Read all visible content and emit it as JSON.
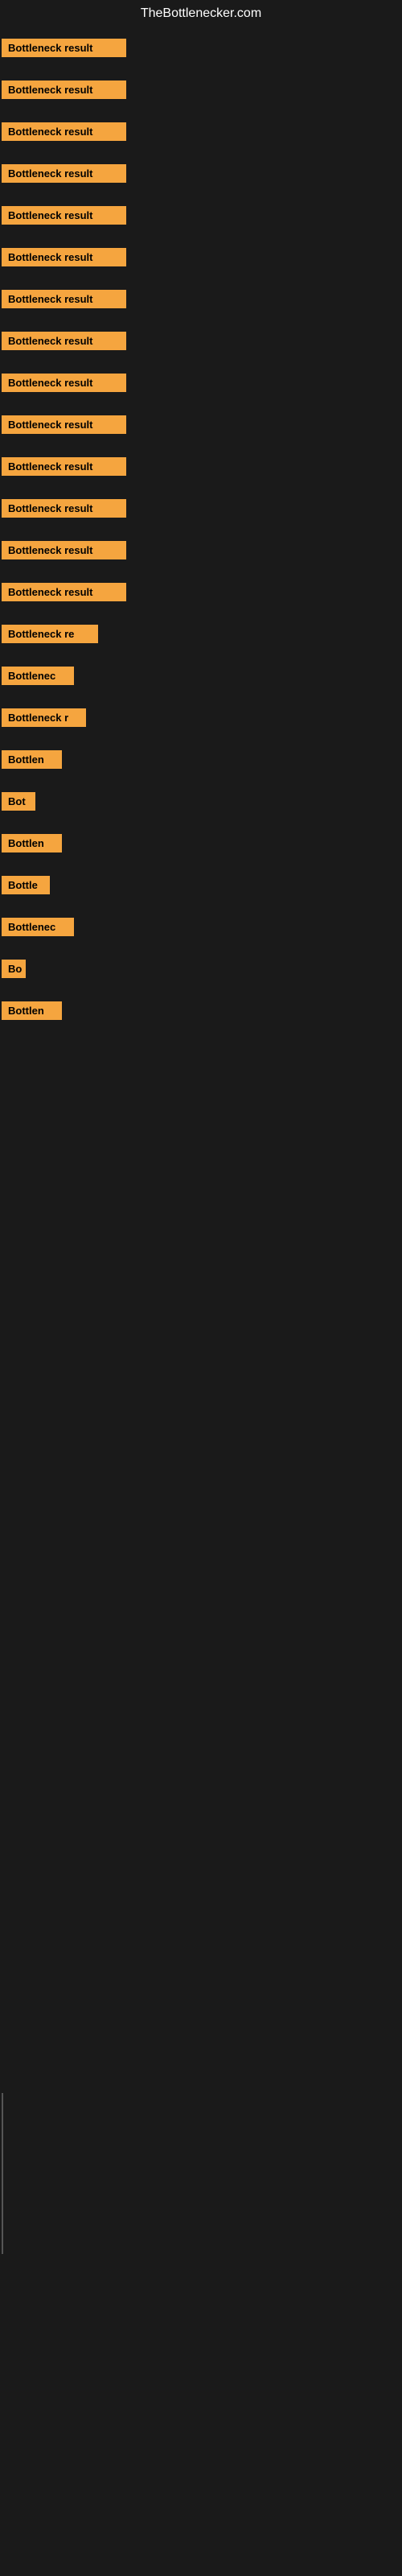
{
  "site": {
    "title": "TheBottlenecker.com"
  },
  "bars": [
    {
      "label": "Bottleneck result",
      "width": 155
    },
    {
      "label": "Bottleneck result",
      "width": 155
    },
    {
      "label": "Bottleneck result",
      "width": 155
    },
    {
      "label": "Bottleneck result",
      "width": 155
    },
    {
      "label": "Bottleneck result",
      "width": 155
    },
    {
      "label": "Bottleneck result",
      "width": 155
    },
    {
      "label": "Bottleneck result",
      "width": 155
    },
    {
      "label": "Bottleneck result",
      "width": 155
    },
    {
      "label": "Bottleneck result",
      "width": 155
    },
    {
      "label": "Bottleneck result",
      "width": 155
    },
    {
      "label": "Bottleneck result",
      "width": 155
    },
    {
      "label": "Bottleneck result",
      "width": 155
    },
    {
      "label": "Bottleneck result",
      "width": 155
    },
    {
      "label": "Bottleneck result",
      "width": 155
    },
    {
      "label": "Bottleneck re",
      "width": 120
    },
    {
      "label": "Bottlenec",
      "width": 90
    },
    {
      "label": "Bottleneck r",
      "width": 105
    },
    {
      "label": "Bottlen",
      "width": 75
    },
    {
      "label": "Bot",
      "width": 42
    },
    {
      "label": "Bottlen",
      "width": 75
    },
    {
      "label": "Bottle",
      "width": 60
    },
    {
      "label": "Bottlenec",
      "width": 90
    },
    {
      "label": "Bo",
      "width": 30
    },
    {
      "label": "Bottlen",
      "width": 75
    }
  ],
  "colors": {
    "bar_bg": "#f5a53f",
    "bar_text": "#000000",
    "site_title": "#ffffff",
    "background": "#1a1a1a"
  }
}
